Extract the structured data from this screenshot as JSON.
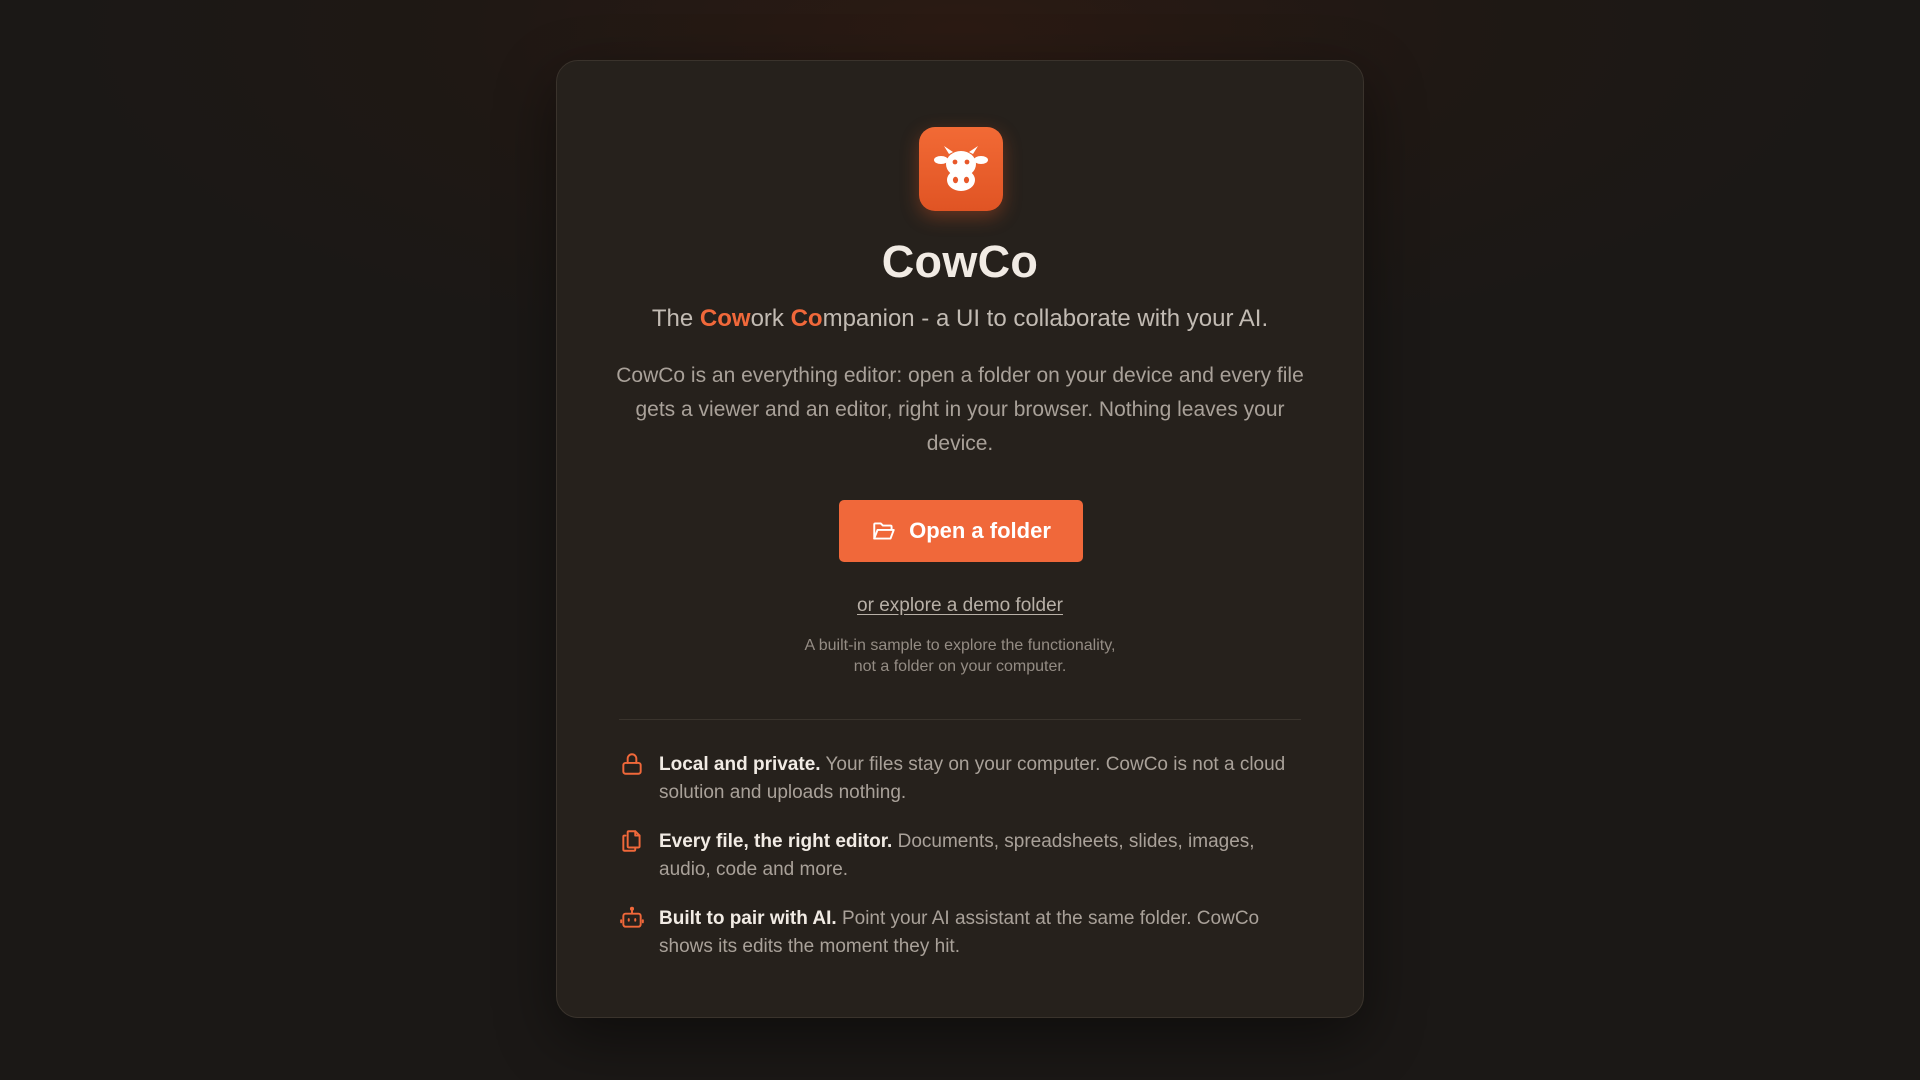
{
  "app": {
    "name": "CowCo",
    "logo_icon": "cow-icon",
    "accent_color": "#f0683a"
  },
  "tagline": {
    "prefix": "The ",
    "hl1": "Cow",
    "part2": "ork ",
    "hl2": "Co",
    "suffix": "mpanion - a UI to collaborate with your AI."
  },
  "description": "CowCo is an everything editor: open a folder on your device and every file gets a viewer and an editor, right in your browser. Nothing leaves your device.",
  "open_button": {
    "label": "Open a folder",
    "icon": "folder-open-icon"
  },
  "demo": {
    "link_label": "or explore a demo folder",
    "note_line1": "A built-in sample to explore the functionality,",
    "note_line2": "not a folder on your computer."
  },
  "features": [
    {
      "icon": "lock-icon",
      "heading": "Local and private.",
      "text": " Your files stay on your computer. CowCo is not a cloud solution and uploads nothing."
    },
    {
      "icon": "files-icon",
      "heading": "Every file, the right editor.",
      "text": " Documents, spreadsheets, slides, images, audio, code and more."
    },
    {
      "icon": "robot-icon",
      "heading": "Built to pair with AI.",
      "text": " Point your AI assistant at the same folder. CowCo shows its edits the moment they hit."
    }
  ]
}
